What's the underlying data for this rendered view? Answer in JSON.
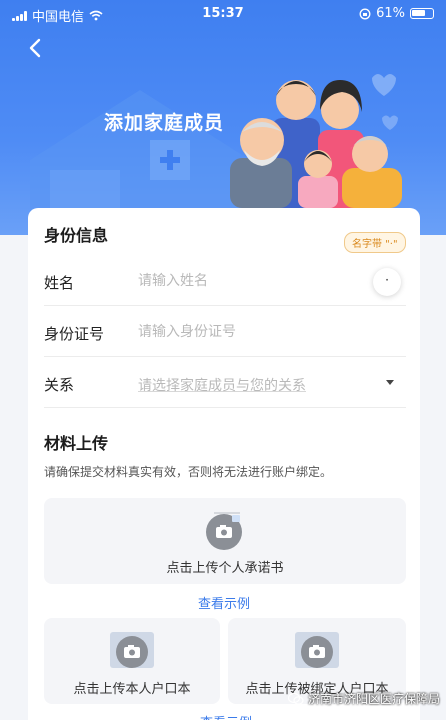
{
  "status_bar": {
    "carrier": "中国电信",
    "time": "15:37",
    "battery": "61%"
  },
  "header": {
    "title": "添加家庭成员"
  },
  "identity": {
    "section_title": "身份信息",
    "name_tip": "名字带 \"·\"",
    "dot_button": "·",
    "name": {
      "label": "姓名",
      "placeholder": "请输入姓名",
      "value": ""
    },
    "id_number": {
      "label": "身份证号",
      "placeholder": "请输入身份证号",
      "value": ""
    },
    "relation": {
      "label": "关系",
      "placeholder": "请选择家庭成员与您的关系"
    }
  },
  "materials": {
    "section_title": "材料上传",
    "note": "请确保提交材料真实有效，否则将无法进行账户绑定。",
    "commitment": {
      "label": "点击上传个人承诺书",
      "example": "查看示例"
    },
    "own_hukou": {
      "label": "点击上传本人户口本"
    },
    "bound_hukou": {
      "label": "点击上传被绑定人户口本"
    },
    "bottom_example": "查看示例"
  },
  "watermark": "济南市济阳区医疗保障局",
  "colors": {
    "primary": "#3b7bea",
    "header_bg": "#4f8cf5",
    "tip_text": "#d9891d"
  }
}
